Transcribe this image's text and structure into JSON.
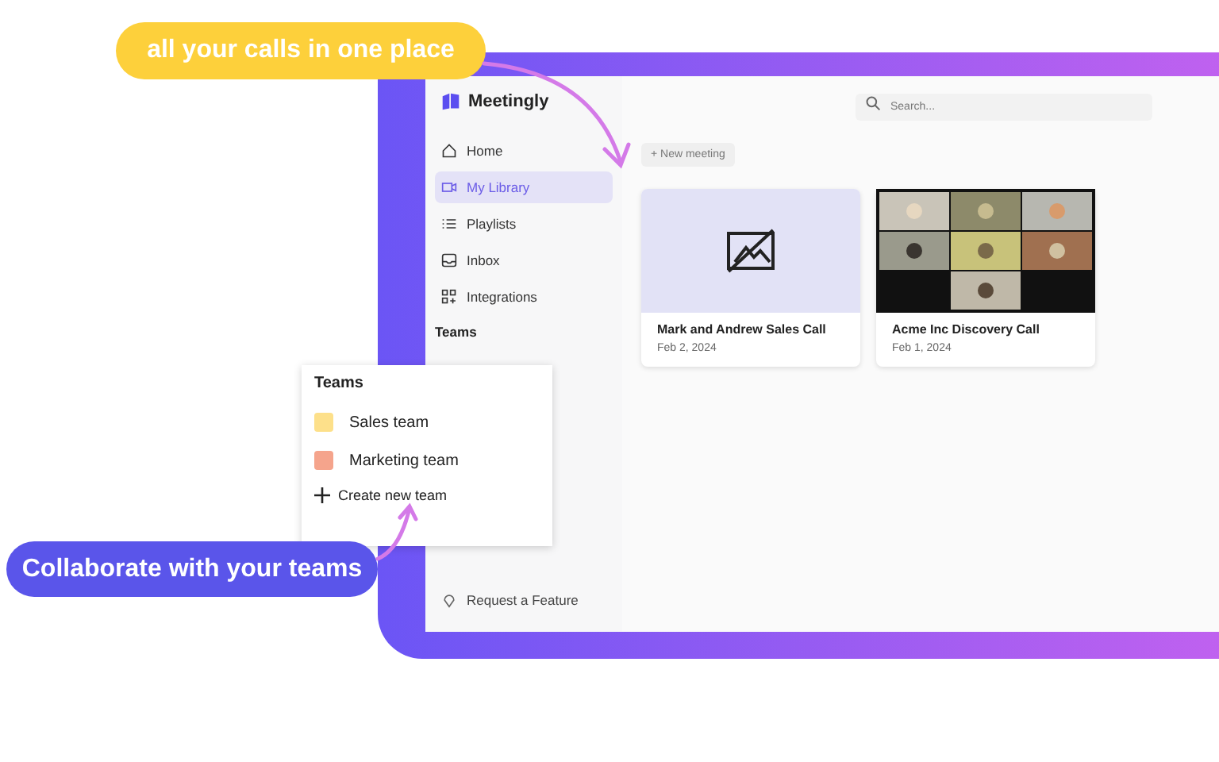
{
  "callouts": [
    {
      "text": "all your calls in one place",
      "kind": "yellow"
    },
    {
      "text": "Collaborate with your teams",
      "kind": "blue"
    }
  ],
  "app": {
    "logo": "Meetingly",
    "search": {
      "placeholder": "Search..."
    },
    "sidebar": {
      "items": [
        {
          "label": "Home",
          "selected": false
        },
        {
          "label": "My Library",
          "selected": true
        },
        {
          "label": "Playlists",
          "selected": false
        },
        {
          "label": "Inbox",
          "selected": false
        },
        {
          "label": "Integrations",
          "selected": false
        }
      ],
      "section": "Teams",
      "footer": "Request a Feature"
    },
    "new_meeting": "+ New meeting",
    "meetings": [
      {
        "title": "Mark and Andrew Sales Call",
        "date": "Feb 2, 2024",
        "kind": "placeholder"
      },
      {
        "title": "Acme Inc Discovery Call",
        "date": "Feb 1, 2024",
        "kind": "picture"
      }
    ]
  },
  "teams_popup": {
    "title": "Teams",
    "teams": [
      {
        "name": "Sales team",
        "color": "#fde08a"
      },
      {
        "name": "Marketing team",
        "color": "#f5a48c"
      }
    ],
    "create": "Create new team"
  }
}
